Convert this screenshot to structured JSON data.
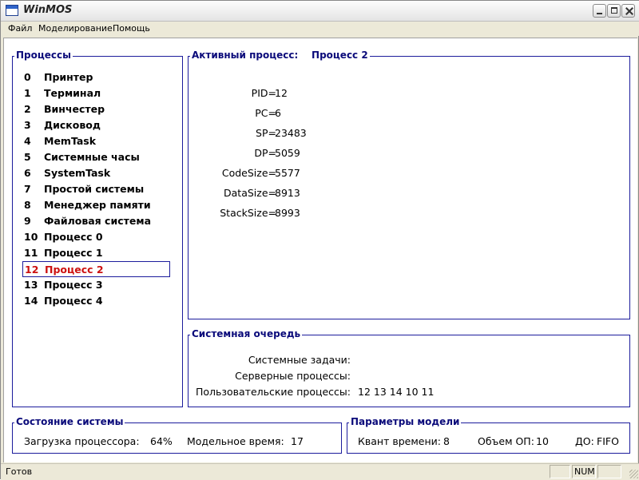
{
  "window": {
    "title": "WinMOS"
  },
  "menu": [
    "Файл",
    "Моделирование",
    "Помощь"
  ],
  "processes_panel": {
    "title": "Процессы",
    "selected_index": 12,
    "items": [
      {
        "id": "0",
        "name": "Принтер"
      },
      {
        "id": "1",
        "name": "Терминал"
      },
      {
        "id": "2",
        "name": "Винчестер"
      },
      {
        "id": "3",
        "name": "Дисковод"
      },
      {
        "id": "4",
        "name": "MemTask"
      },
      {
        "id": "5",
        "name": "Системные часы"
      },
      {
        "id": "6",
        "name": "SystemTask"
      },
      {
        "id": "7",
        "name": "Простой системы"
      },
      {
        "id": "8",
        "name": "Менеджер памяти"
      },
      {
        "id": "9",
        "name": "Файловая система"
      },
      {
        "id": "10",
        "name": "Процесс 0"
      },
      {
        "id": "11",
        "name": "Процесс 1"
      },
      {
        "id": "12",
        "name": "Процесс 2"
      },
      {
        "id": "13",
        "name": "Процесс 3"
      },
      {
        "id": "14",
        "name": "Процесс 4"
      }
    ]
  },
  "active_process": {
    "title": "Активный процесс:",
    "name": "Процесс 2",
    "fields": [
      {
        "label": "PID=",
        "value": "12"
      },
      {
        "label": "PC=",
        "value": "6"
      },
      {
        "label": "SP=",
        "value": "23483"
      },
      {
        "label": "DP=",
        "value": "5059"
      },
      {
        "label": "CodeSize=",
        "value": "5577"
      },
      {
        "label": "DataSize=",
        "value": "8913"
      },
      {
        "label": "StackSize=",
        "value": "8993"
      }
    ]
  },
  "system_queue": {
    "title": "Системная очередь",
    "rows": [
      {
        "label": "Системные задачи:",
        "value": ""
      },
      {
        "label": "Серверные процессы:",
        "value": ""
      },
      {
        "label": "Пользовательские процессы:",
        "value": "12 13 14 10 11"
      }
    ]
  },
  "system_state": {
    "title": "Состояние системы",
    "cpu_label": "Загрузка процессора:",
    "cpu_value": "64%",
    "time_label": "Модельное время:",
    "time_value": "17"
  },
  "model_params": {
    "title": "Параметры модели",
    "quantum_label": "Квант времени:",
    "quantum_value": "8",
    "memory_label": "Объем ОП:",
    "memory_value": "10",
    "policy_label": "ДО:",
    "policy_value": "FIFO"
  },
  "status_bar": {
    "text": "Готов",
    "num": "NUM"
  }
}
